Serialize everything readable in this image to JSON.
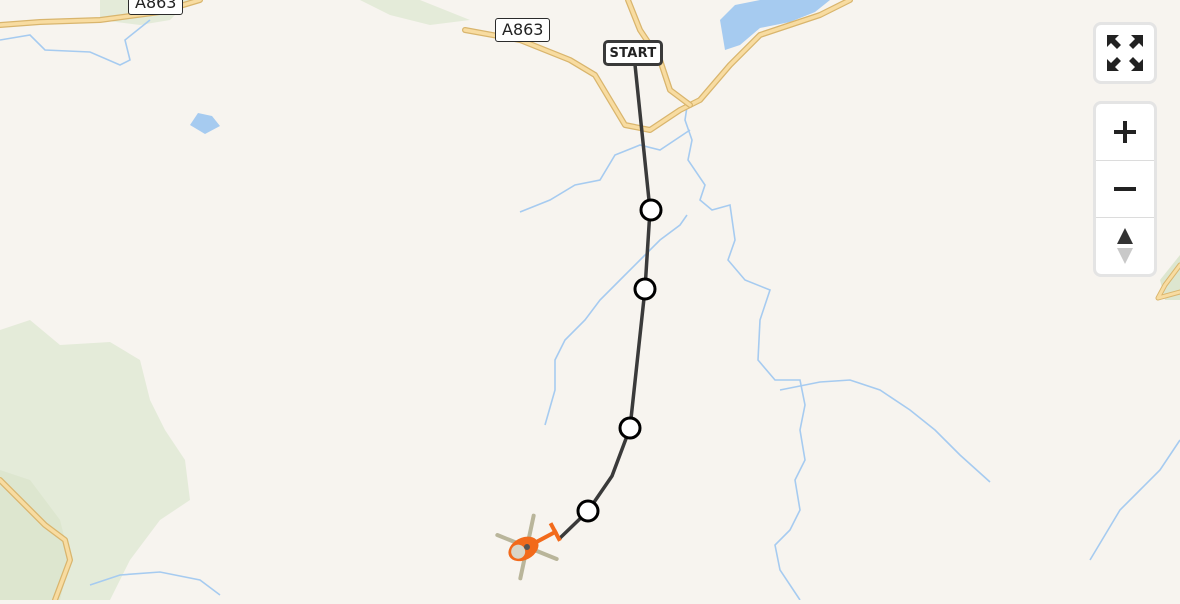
{
  "map": {
    "road_labels": [
      "A863",
      "A863"
    ],
    "start_label": "START",
    "waypoint_count": 4
  },
  "controls": {
    "fullscreen_icon": "fullscreen-icon",
    "zoom_in_icon": "plus-icon",
    "zoom_out_icon": "minus-icon",
    "compass_icon": "north-arrow-icon"
  },
  "marker": {
    "icon": "helicopter-icon"
  },
  "colors": {
    "land": "#f7f4ef",
    "park": "#e4ebd9",
    "water": "#a6cbf0",
    "road": "#f4d089",
    "route": "#3a3a3a",
    "marker_accent": "#f26a1b"
  }
}
